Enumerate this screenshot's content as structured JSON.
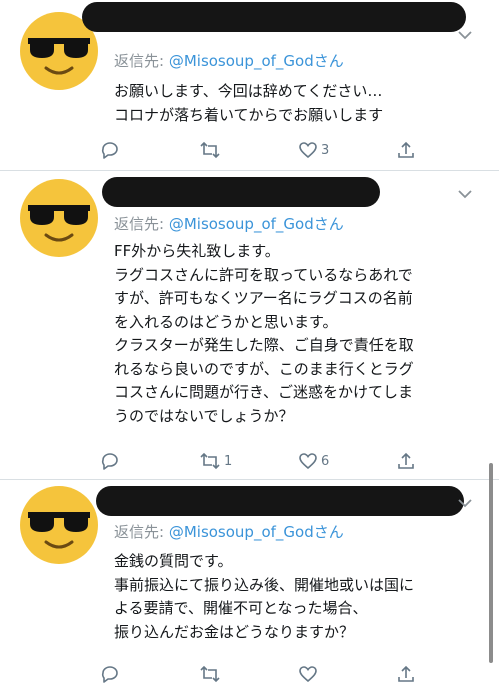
{
  "tweets": [
    {
      "reply_prefix": "返信先: ",
      "reply_handle": "@Misosoup_of_Godさん",
      "lines": [
        "お願いします、今回は辞めてください…",
        "コロナが落ち着いてからでお願いします"
      ],
      "counts": {
        "reply": "",
        "retweet": "",
        "like": "3"
      }
    },
    {
      "reply_prefix": "返信先: ",
      "reply_handle": "@Misosoup_of_Godさん",
      "lines": [
        "FF外から失礼致します。",
        "ラグコスさんに許可を取っているならあれで",
        "すが、許可もなくツアー名にラグコスの名前",
        "を入れるのはどうかと思います。",
        "クラスターが発生した際、ご自身で責任を取",
        "れるなら良いのですが、このまま行くとラグ",
        "コスさんに問題が行き、ご迷惑をかけてしま",
        "うのではないでしょうか？"
      ],
      "counts": {
        "reply": "",
        "retweet": "1",
        "like": "6"
      }
    },
    {
      "reply_prefix": "返信先: ",
      "reply_handle": "@Misosoup_of_Godさん",
      "lines": [
        "金銭の質問です。",
        "事前振込にて振り込み後、開催地或いは国に",
        "よる要請で、開催不可となった場合、",
        "振り込んだお金はどうなりますか？"
      ],
      "counts": {
        "reply": "",
        "retweet": "",
        "like": ""
      }
    }
  ],
  "icons": {
    "reply": "reply-icon",
    "retweet": "retweet-icon",
    "like": "heart-icon",
    "share": "share-icon",
    "avatar": "sunglasses-emoji-avatar"
  },
  "colors": {
    "avatar": "#f5c43c",
    "handle": "#3b94d9",
    "meta": "#8a9298",
    "icon": "#657786"
  }
}
